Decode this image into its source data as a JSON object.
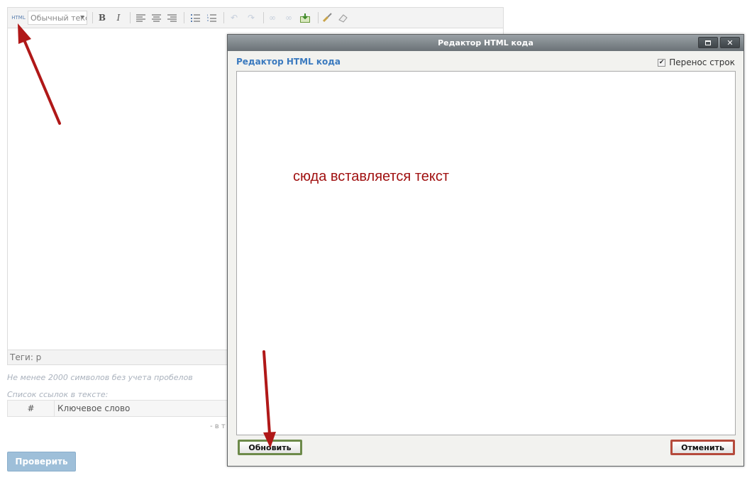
{
  "editor": {
    "toolbar": {
      "html_label": "HTML",
      "format_select": "Обычный текст",
      "bold_label": "B",
      "italic_label": "I",
      "icons": [
        "align-left-icon",
        "align-center-icon",
        "align-right-icon",
        "bullet-list-icon",
        "numbered-list-icon",
        "undo-icon",
        "redo-icon",
        "link-icon",
        "unlink-icon",
        "insert-image-icon",
        "paint-icon",
        "eraser-icon"
      ]
    },
    "tags_label": "Теги: р"
  },
  "hint_min_chars": "Не менее 2000 символов без учета пробелов",
  "links_caption": "Список ссылок в тексте:",
  "links_table": {
    "col_num": "#",
    "col_keyword": "Ключевое слово",
    "footer": "- в т"
  },
  "check_button": "Проверить",
  "dialog": {
    "title": "Редактор HTML кода",
    "heading": "Редактор HTML кода",
    "wrap_label": "Перенос строк",
    "wrap_checked": true,
    "note": "сюда вставляется текст",
    "update_button": "Обновить",
    "cancel_button": "Отменить",
    "maximize_icon": "maximize-icon",
    "close_icon": "close-icon"
  },
  "colors": {
    "annotation_arrow": "#b01818",
    "heading": "#3b7abf",
    "note": "#a01010"
  }
}
